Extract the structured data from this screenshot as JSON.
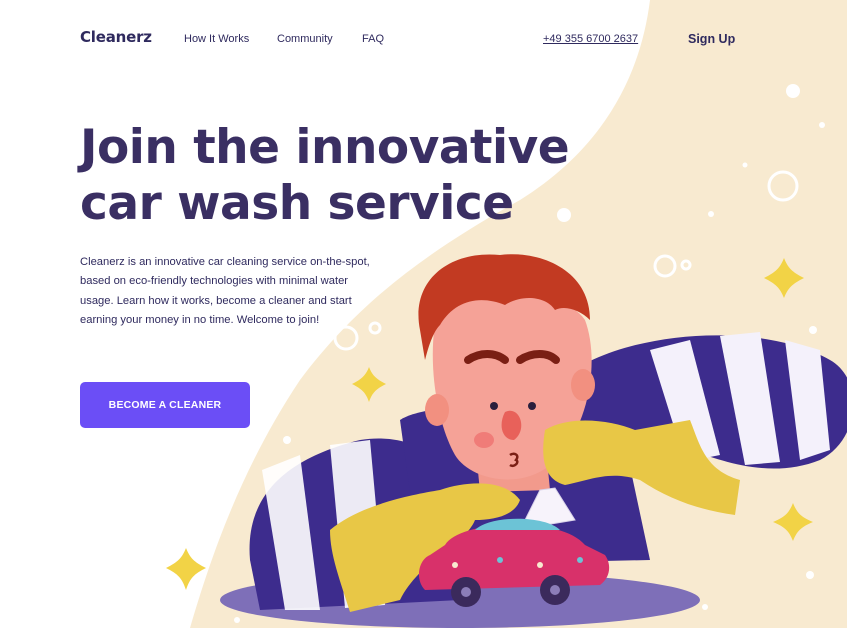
{
  "nav": {
    "logo": "Cleanerz",
    "links": [
      "How It Works",
      "Community",
      "FAQ"
    ],
    "phone": "+49 355 6700 2637",
    "signup": "Sign Up"
  },
  "hero": {
    "title_line1": "Join the innovative",
    "title_line2": "car wash service",
    "description": "Cleanerz is an innovative car cleaning service on-the-spot, based on eco-friendly technologies with minimal water usage. Learn how it works, become a cleaner and start earning your money in no time. Welcome to join!",
    "cta_label": "BECOME A CLEANER"
  },
  "colors": {
    "brand_dark": "#3a2f63",
    "accent": "#6b4ef6",
    "cream": "#f8ead0",
    "stripe_purple": "#3d2c8d",
    "glove_yellow": "#e8c746",
    "hair_red": "#c23a22",
    "car_pink": "#d8316a"
  }
}
